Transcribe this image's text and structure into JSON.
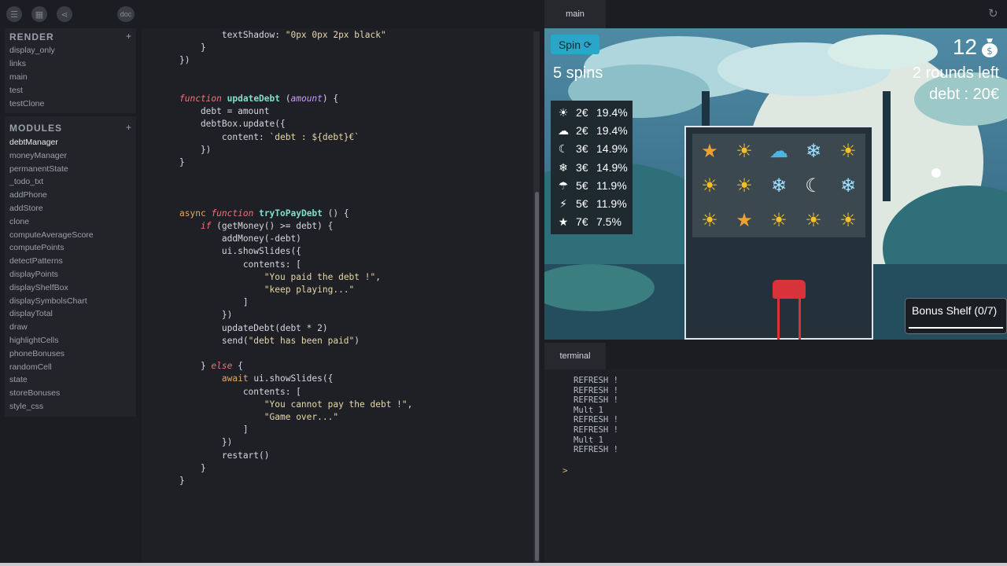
{
  "toolbar": {
    "doc_label": "doc",
    "icons": [
      "menu-icon",
      "grid-icon",
      "share-icon"
    ]
  },
  "sidebar": {
    "render_title": "RENDER",
    "render_items": [
      "display_only",
      "links",
      "main",
      "test",
      "testClone"
    ],
    "modules_title": "MODULES",
    "module_items": [
      "debtManager",
      "moneyManager",
      "permanentState",
      "_todo_txt",
      "addPhone",
      "addStore",
      "clone",
      "computeAverageScore",
      "computePoints",
      "detectPatterns",
      "displayPoints",
      "displayShelfBox",
      "displaySymbolsChart",
      "displayTotal",
      "draw",
      "highlightCells",
      "phoneBonuses",
      "randomCell",
      "state",
      "storeBonuses",
      "style_css"
    ],
    "plus": "+"
  },
  "editor": {
    "lines": [
      "        textShadow: \"0px 0px 2px black\"",
      "    }",
      "})",
      "",
      "",
      "function updateDebt (amount) {",
      "    debt = amount",
      "    debtBox.update({",
      "        content: `debt : ${debt}€`",
      "    })",
      "}",
      "",
      "",
      "",
      "async function tryToPayDebt () {",
      "    if (getMoney() >= debt) {",
      "        addMoney(-debt)",
      "        ui.showSlides({",
      "            contents: [",
      "                \"You paid the debt !\",",
      "                \"keep playing...\"",
      "            ]",
      "        })",
      "        updateDebt(debt * 2)",
      "        send(\"debt has been paid\")",
      "",
      "    } else {",
      "        await ui.showSlides({",
      "            contents: [",
      "                \"You cannot pay the debt !\",",
      "                \"Game over...\"",
      "            ]",
      "        })",
      "        restart()",
      "    }",
      "}"
    ]
  },
  "right": {
    "tab_main": "main",
    "tab_terminal": "terminal"
  },
  "game": {
    "spin_label": "Spin",
    "spins": "5 spins",
    "money": "12",
    "rounds": "2 rounds left",
    "debt": "debt : 20€",
    "odds": [
      {
        "icon": "sun-icon",
        "glyph": "☀",
        "price": "2€",
        "pct": "19.4%"
      },
      {
        "icon": "cloud-icon",
        "glyph": "☁",
        "price": "2€",
        "pct": "19.4%"
      },
      {
        "icon": "moon-icon",
        "glyph": "☾",
        "price": "3€",
        "pct": "14.9%"
      },
      {
        "icon": "snowflake-icon",
        "glyph": "❄",
        "price": "3€",
        "pct": "14.9%"
      },
      {
        "icon": "umbrella-icon",
        "glyph": "☂",
        "price": "5€",
        "pct": "11.9%"
      },
      {
        "icon": "lightning-icon",
        "glyph": "⚡",
        "price": "5€",
        "pct": "11.9%"
      },
      {
        "icon": "star-icon",
        "glyph": "★",
        "price": "7€",
        "pct": "7.5%"
      }
    ],
    "grid": [
      [
        "star",
        "sun",
        "cloud",
        "snowflake",
        "sun"
      ],
      [
        "sun",
        "sun",
        "snowflake",
        "moon",
        "snowflake"
      ],
      [
        "sun",
        "star",
        "sun",
        "sun",
        "sun"
      ]
    ],
    "bonus_label": "Bonus Shelf (0/7)"
  },
  "terminal": {
    "lines": [
      "REFRESH !",
      "REFRESH !",
      "REFRESH !",
      "Mult 1",
      "REFRESH !",
      "REFRESH !",
      "Mult 1",
      "REFRESH !"
    ],
    "prompt": ">"
  },
  "colors": {
    "accent": "#2aa6c8",
    "sun": "#f4c020",
    "star": "#f0a030",
    "cloud": "#4ab6e0",
    "snow": "#9ee0ff",
    "moon": "#f4f4f0"
  }
}
